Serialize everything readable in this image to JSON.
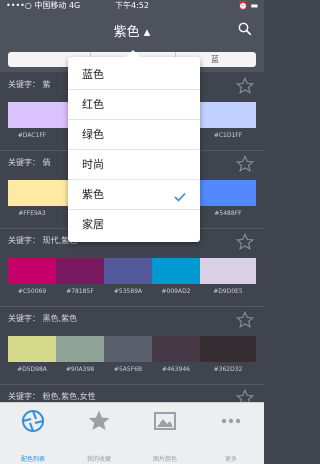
{
  "status_bar": {
    "carrier": "••••○ 中国移动  4G",
    "time": "下午4:52",
    "right": "⏰ ▬"
  },
  "nav": {
    "title": "紫色 ▴"
  },
  "segment": {
    "items": [
      "",
      "",
      "蓝"
    ]
  },
  "menu": {
    "items": [
      {
        "label": "蓝色",
        "checked": false
      },
      {
        "label": "红色",
        "checked": false
      },
      {
        "label": "绿色",
        "checked": false
      },
      {
        "label": "时尚",
        "checked": false
      },
      {
        "label": "紫色",
        "checked": true
      },
      {
        "label": "家居",
        "checked": false
      }
    ]
  },
  "cards": [
    {
      "keyword": "关键字：  紫",
      "colors": [
        "#DAC1FF",
        "#DAC1FF",
        "#DAC1FF",
        "#C1D1FF",
        "#C1D1FF"
      ],
      "hexes": [
        "#DAC1FF",
        "",
        "",
        "",
        "#C1D1FF"
      ]
    },
    {
      "keyword": "关键字：  倘",
      "colors": [
        "#FFE9A3",
        "#FFE9A3",
        "#7a6aa8",
        "#5488FF",
        "#5488FF"
      ],
      "hexes": [
        "#FFE9A3",
        "",
        "",
        "",
        "#5488FF"
      ]
    },
    {
      "keyword": "关键字：  现代,紫色",
      "colors": [
        "#C50069",
        "#78185F",
        "#53589A",
        "#009AD2",
        "#D9D0E5"
      ],
      "hexes": [
        "#C50069",
        "#78185F",
        "#53589A",
        "#009AD2",
        "#D9D0E5"
      ]
    },
    {
      "keyword": "关键字：  黑色,紫色",
      "colors": [
        "#D5D98A",
        "#90A398",
        "#5A5F6B",
        "#463946",
        "#362D32"
      ],
      "hexes": [
        "#D5D98A",
        "#90A398",
        "#5A5F6B",
        "#463946",
        "#362D32"
      ]
    },
    {
      "keyword": "关键字：  粉色,紫色,女性",
      "colors": [
        "#b5648e",
        "#c77aa8",
        "#e889a8",
        "#c8a4d8",
        "#a8d8e8"
      ],
      "hexes": [
        "",
        "",
        "",
        "",
        ""
      ]
    }
  ],
  "tabs": [
    {
      "label": "配色列表",
      "active": true
    },
    {
      "label": "我的收藏",
      "active": false
    },
    {
      "label": "图片颜色",
      "active": false
    },
    {
      "label": "更多",
      "active": false
    }
  ],
  "colors": {
    "accent": "#2f8fd8",
    "nav_bg": "#4d525c",
    "list_bg": "#3f444f"
  }
}
